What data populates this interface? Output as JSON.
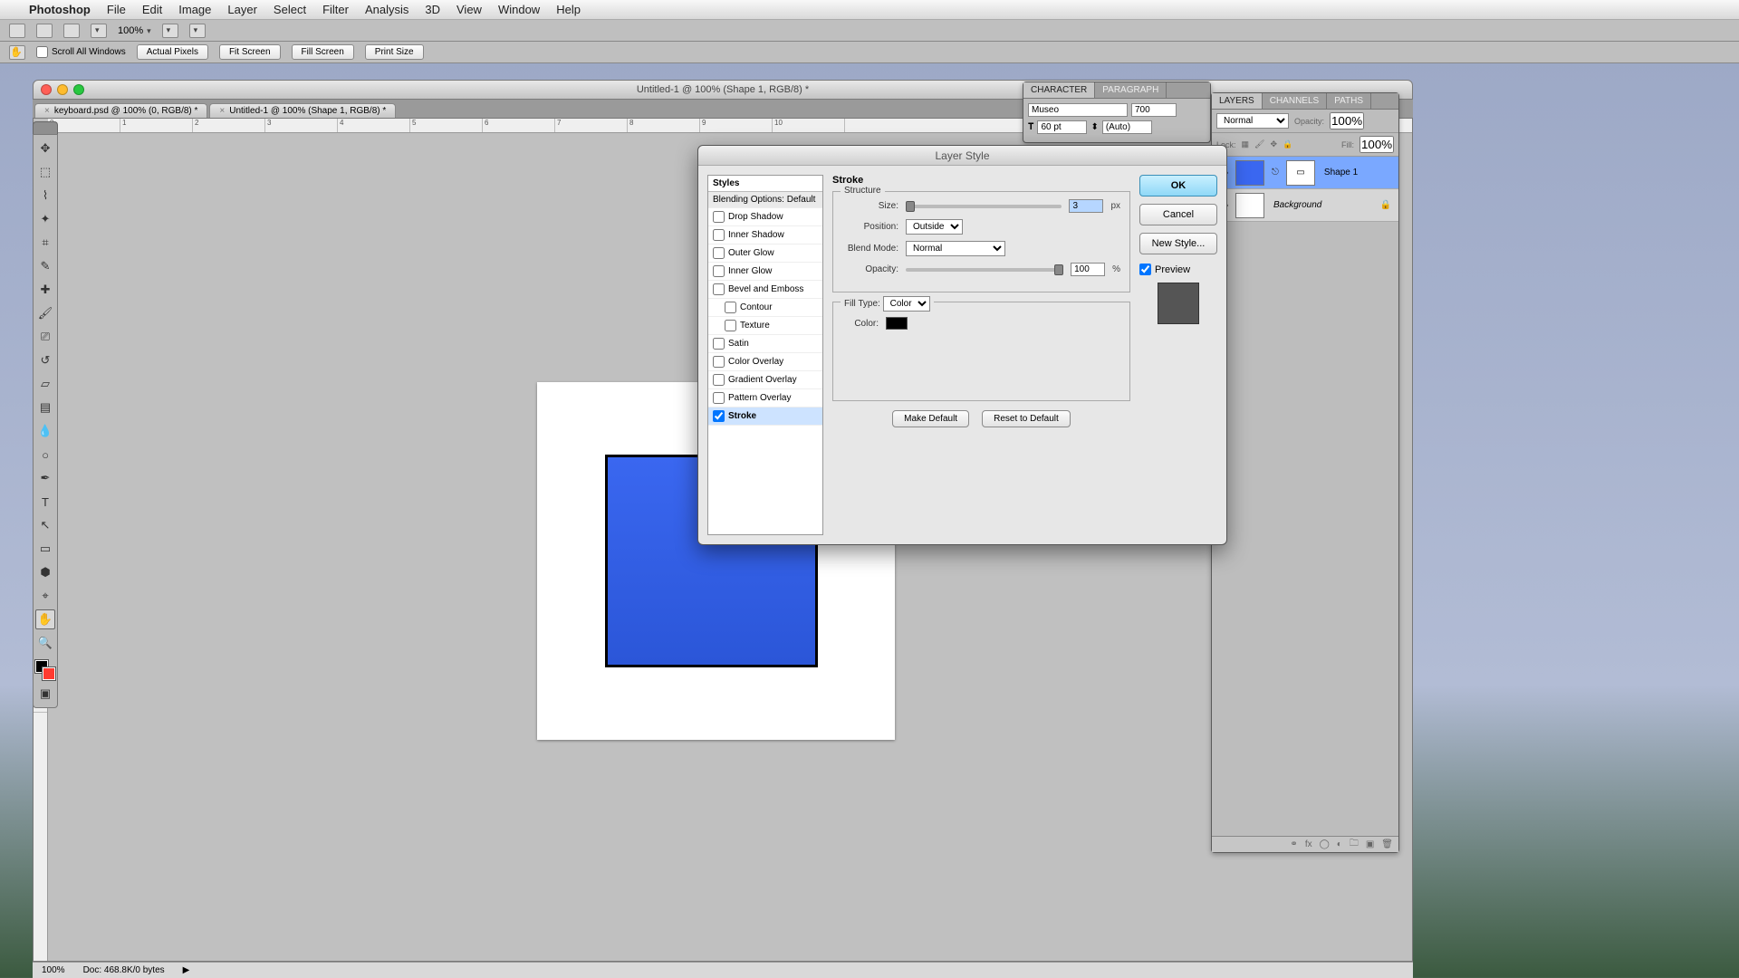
{
  "menubar": {
    "app": "Photoshop",
    "items": [
      "File",
      "Edit",
      "Image",
      "Layer",
      "Select",
      "Filter",
      "Analysis",
      "3D",
      "View",
      "Window",
      "Help"
    ]
  },
  "optrow1": {
    "zoom": "100%"
  },
  "optrow2": {
    "scroll": "Scroll All Windows",
    "actual": "Actual Pixels",
    "fit": "Fit Screen",
    "fill": "Fill Screen",
    "print": "Print Size"
  },
  "doc": {
    "title": "Untitled-1 @ 100% (Shape 1, RGB/8) *",
    "tabs": [
      "keyboard.psd @ 100% (0, RGB/8) *",
      "Untitled-1 @ 100% (Shape 1, RGB/8) *"
    ],
    "zoom": "100%",
    "docinfo": "Doc: 468.8K/0 bytes"
  },
  "ruler": [
    "0",
    "1",
    "2",
    "3",
    "4",
    "5",
    "6",
    "7",
    "8",
    "9",
    "10"
  ],
  "charpanel": {
    "tabs": [
      "CHARACTER",
      "PARAGRAPH"
    ],
    "font": "Museo",
    "weight": "700",
    "size": "60 pt",
    "leading": "(Auto)"
  },
  "layerspanel": {
    "tabs": [
      "LAYERS",
      "CHANNELS",
      "PATHS"
    ],
    "blend": "Normal",
    "opacity_label": "Opacity:",
    "opacity": "100%",
    "lock": "Lock:",
    "fill_label": "Fill:",
    "fill": "100%",
    "layers": [
      {
        "name": "Shape 1"
      },
      {
        "name": "Background"
      }
    ]
  },
  "dialog": {
    "title": "Layer Style",
    "styles_header": "Styles",
    "blending": "Blending Options: Default",
    "effects": [
      "Drop Shadow",
      "Inner Shadow",
      "Outer Glow",
      "Inner Glow",
      "Bevel and Emboss",
      "Contour",
      "Texture",
      "Satin",
      "Color Overlay",
      "Gradient Overlay",
      "Pattern Overlay",
      "Stroke"
    ],
    "section": "Stroke",
    "group1": "Structure",
    "group2": "Fill Type:",
    "size_label": "Size:",
    "size": "3",
    "size_unit": "px",
    "pos_label": "Position:",
    "position": "Outside",
    "blend_label": "Blend Mode:",
    "blend": "Normal",
    "opac_label": "Opacity:",
    "opacity": "100",
    "opac_unit": "%",
    "fill_label": "Fill Type:",
    "fill": "Color",
    "color_label": "Color:",
    "make_default": "Make Default",
    "reset_default": "Reset to Default",
    "ok": "OK",
    "cancel": "Cancel",
    "newstyle": "New Style...",
    "preview": "Preview"
  }
}
